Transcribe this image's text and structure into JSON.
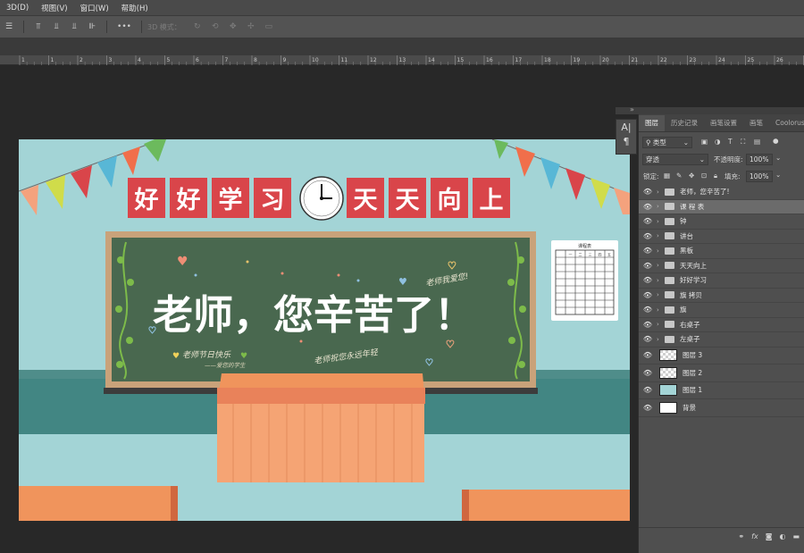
{
  "menubar": {
    "items": [
      "3D(D)",
      "视图(V)",
      "窗口(W)",
      "帮助(H)"
    ]
  },
  "optionsbar": {
    "more": "•••",
    "mode3d_label": "3D 模式："
  },
  "ruler": {
    "labels": [
      "1",
      "1",
      "2",
      "3",
      "4",
      "5",
      "6",
      "7",
      "8",
      "9",
      "10",
      "11",
      "12",
      "13",
      "14",
      "15",
      "16",
      "17",
      "18",
      "19",
      "20",
      "21",
      "22",
      "23",
      "24",
      "25",
      "26",
      "27"
    ]
  },
  "artwork": {
    "title_left": [
      "好",
      "好",
      "学",
      "习"
    ],
    "title_right": [
      "天",
      "天",
      "向",
      "上"
    ],
    "board_title": "老师，您辛苦了！",
    "chalk_right_top": "老师我爱您!",
    "chalk_left": "老师节日快乐",
    "chalk_left_sign": "——爱您的学生",
    "chalk_bottom": "老师祝您永远年轻",
    "schedule_title": "课程表",
    "schedule_headers": [
      "一",
      "二",
      "三",
      "四",
      "五"
    ]
  },
  "minitools": {
    "items": [
      "A|",
      "¶"
    ]
  },
  "panel": {
    "tabs": [
      "图层",
      "历史记录",
      "画笔设置",
      "画笔",
      "Coolorus 2.5"
    ],
    "filter_label": "类型",
    "blend_mode": "穿透",
    "opacity_label": "不透明度:",
    "opacity_value": "100%",
    "lock_label": "锁定:",
    "fill_label": "填充:",
    "fill_value": "100%",
    "layers": [
      {
        "name": "老师，您辛苦了!",
        "kind": "group"
      },
      {
        "name": "课 程 表",
        "kind": "group",
        "active": true
      },
      {
        "name": "钟",
        "kind": "group"
      },
      {
        "name": "讲台",
        "kind": "group"
      },
      {
        "name": "黑板",
        "kind": "group"
      },
      {
        "name": "天天向上",
        "kind": "group"
      },
      {
        "name": "好好学习",
        "kind": "group"
      },
      {
        "name": "旗 拷贝",
        "kind": "group"
      },
      {
        "name": "旗",
        "kind": "group"
      },
      {
        "name": "右桌子",
        "kind": "group"
      },
      {
        "name": "左桌子",
        "kind": "group"
      },
      {
        "name": "图层 3",
        "kind": "layer",
        "thumb": "checker"
      },
      {
        "name": "图层 2",
        "kind": "layer",
        "thumb": "checker"
      },
      {
        "name": "图层 1",
        "kind": "layer",
        "thumb": "teal"
      },
      {
        "name": "背景",
        "kind": "layer",
        "thumb": "white"
      }
    ],
    "bottom_icons": [
      "link-icon",
      "fx-icon",
      "mask-icon",
      "adjustment-icon",
      "group-icon"
    ]
  }
}
